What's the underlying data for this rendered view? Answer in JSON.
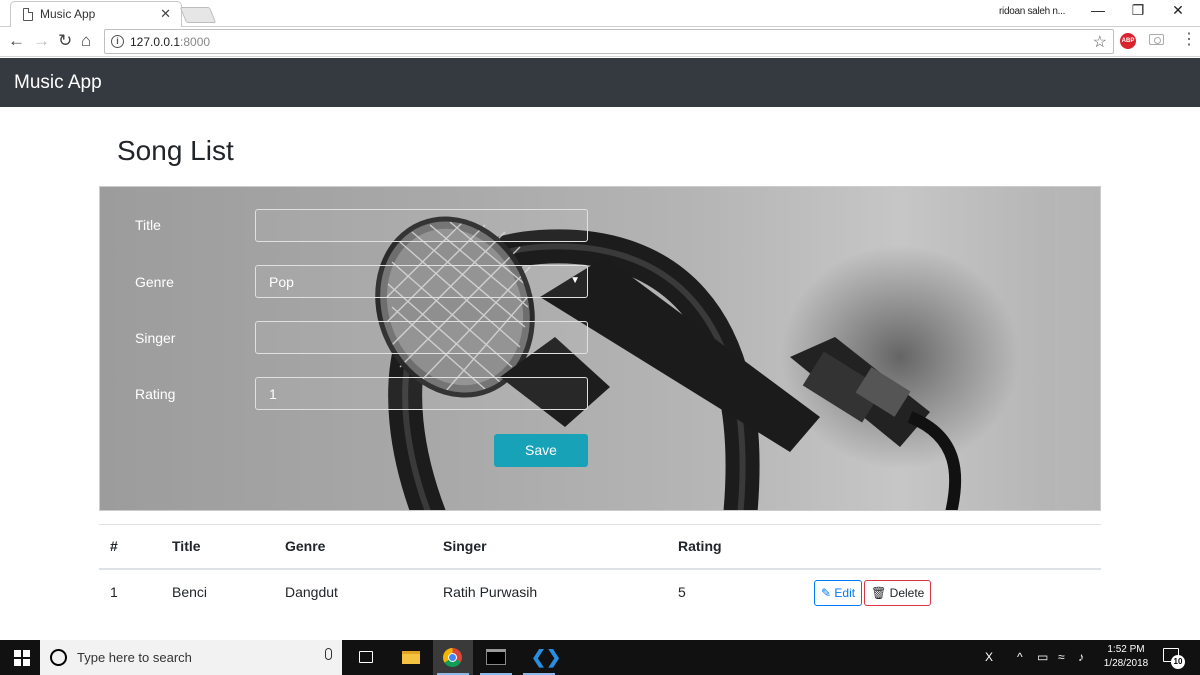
{
  "browser": {
    "tab_title": "Music App",
    "tab_close": "✕",
    "profile_name": "ridoan saleh n...",
    "url_host": "127.0.0.1",
    "url_port": ":8000",
    "abp_label": "ABP"
  },
  "app": {
    "brand": "Music App",
    "page_title": "Song List"
  },
  "form": {
    "title_label": "Title",
    "title_value": "",
    "genre_label": "Genre",
    "genre_value": "Pop",
    "singer_label": "Singer",
    "singer_value": "",
    "rating_label": "Rating",
    "rating_value": "1",
    "save_label": "Save"
  },
  "table": {
    "headers": [
      "#",
      "Title",
      "Genre",
      "Singer",
      "Rating"
    ],
    "rows": [
      {
        "num": "1",
        "title": "Benci",
        "genre": "Dangdut",
        "singer": "Ratih Purwasih",
        "rating": "5"
      }
    ],
    "edit_label": "Edit",
    "delete_label": "Delete"
  },
  "taskbar": {
    "search_placeholder": "Type here to search",
    "time": "1:52 PM",
    "date": "1/28/2018",
    "notification_count": "10"
  },
  "colors": {
    "navbar": "#343a40",
    "save_button": "#17a2b8",
    "edit_border": "#007bff",
    "delete_border": "#dc3545"
  }
}
